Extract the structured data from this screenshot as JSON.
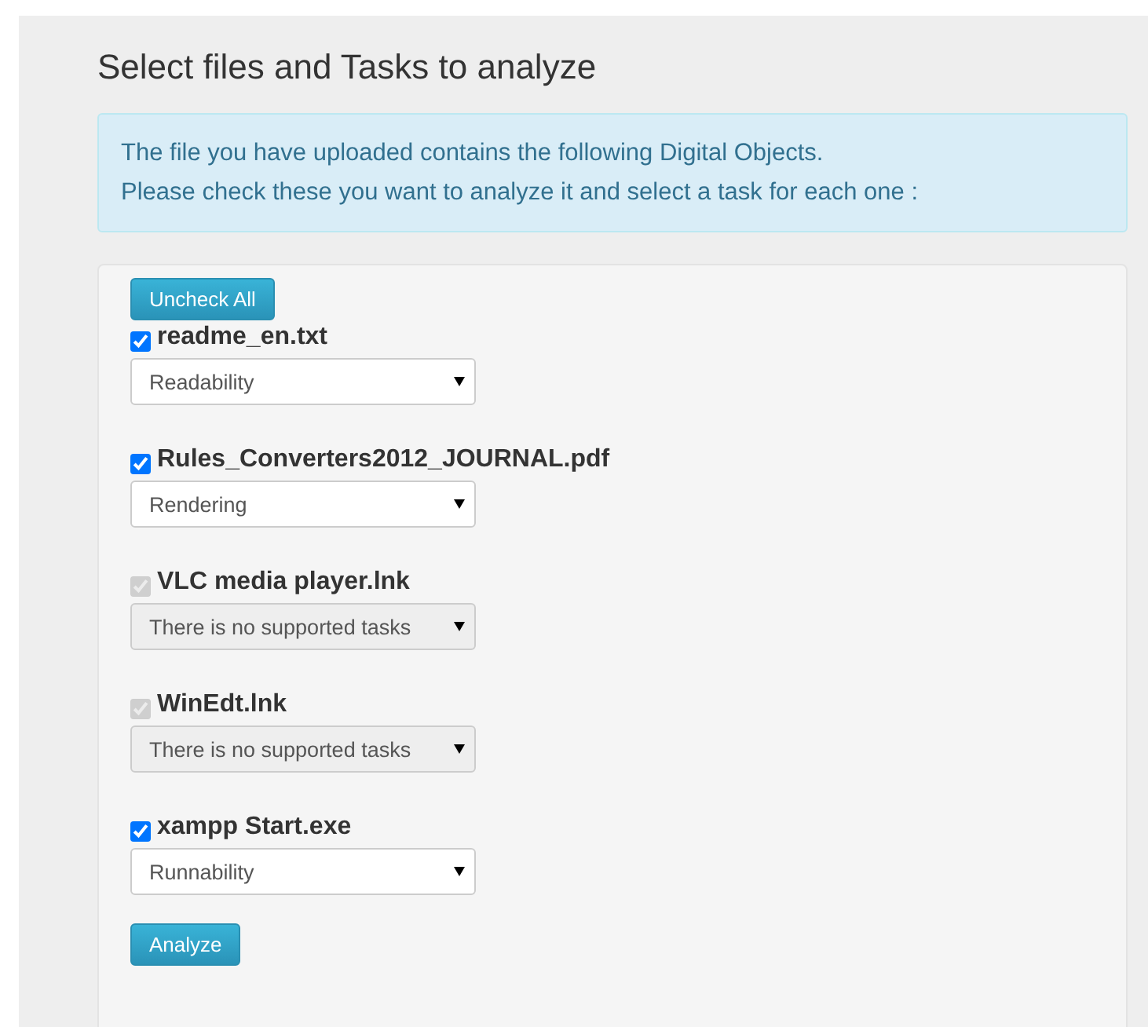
{
  "title": "Select files and Tasks to analyze",
  "notice": [
    "The file you have uploaded contains the following Digital Objects.",
    "Please check these you want to analyze it and select a task for each one :"
  ],
  "uncheck_button": "Uncheck All",
  "files": [
    {
      "name": "readme_en.txt",
      "checked": true,
      "disabled": false,
      "task": "Readability"
    },
    {
      "name": "Rules_Converters2012_JOURNAL.pdf",
      "checked": true,
      "disabled": false,
      "task": "Rendering"
    },
    {
      "name": "VLC media player.lnk",
      "checked": true,
      "disabled": true,
      "task": "There is no supported tasks"
    },
    {
      "name": "WinEdt.lnk",
      "checked": true,
      "disabled": true,
      "task": "There is no supported tasks"
    },
    {
      "name": "xampp Start.exe",
      "checked": true,
      "disabled": false,
      "task": "Runnability"
    }
  ],
  "analyze_button": "Analyze"
}
